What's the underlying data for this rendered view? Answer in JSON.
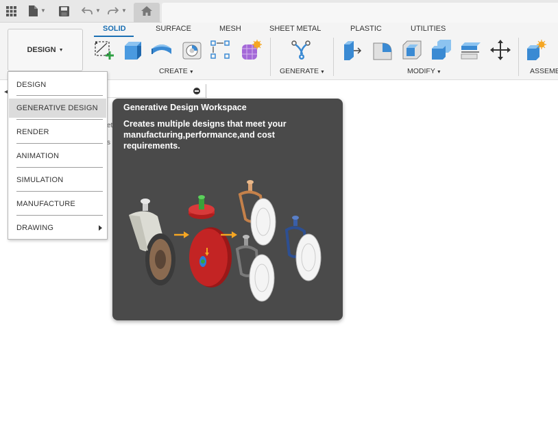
{
  "appbar": {
    "icons": [
      "grid-icon",
      "file-icon",
      "save-icon",
      "undo-icon",
      "redo-icon",
      "home-icon"
    ]
  },
  "toolbar": {
    "workspace_label": "DESIGN",
    "tabs": [
      {
        "label": "SOLID",
        "active": true
      },
      {
        "label": "SURFACE",
        "active": false
      },
      {
        "label": "MESH",
        "active": false
      },
      {
        "label": "SHEET METAL",
        "active": false
      },
      {
        "label": "PLASTIC",
        "active": false
      },
      {
        "label": "UTILITIES",
        "active": false
      }
    ],
    "groups": [
      {
        "label": "CREATE"
      },
      {
        "label": "GENERATE"
      },
      {
        "label": "MODIFY"
      },
      {
        "label": "ASSEMB"
      }
    ]
  },
  "browser": {
    "fragments": [
      "eti",
      "s"
    ]
  },
  "menu": {
    "items": [
      {
        "label": "DESIGN"
      },
      {
        "label": "GENERATIVE DESIGN"
      },
      {
        "label": "RENDER"
      },
      {
        "label": "ANIMATION"
      },
      {
        "label": "SIMULATION"
      },
      {
        "label": "MANUFACTURE"
      },
      {
        "label": "DRAWING"
      }
    ]
  },
  "tooltip": {
    "title": "Generative Design Workspace",
    "description": "Creates multiple designs that meet your manufacturing,performance,and cost requirements."
  },
  "colors": {
    "accent": "#1a6fb3",
    "tooltip_bg": "#4a4a4a",
    "menu_hover": "#dcdcdc"
  }
}
